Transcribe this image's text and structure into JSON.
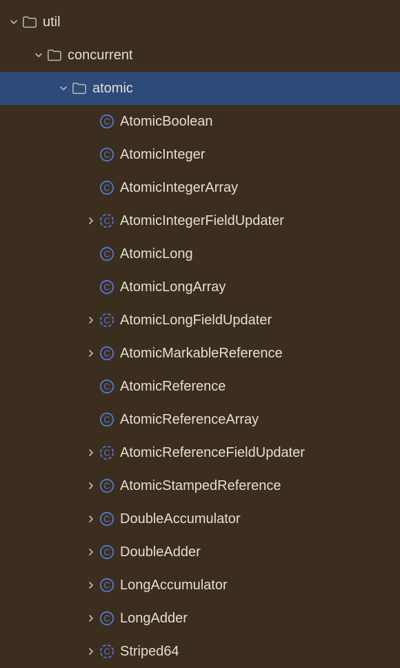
{
  "tree": {
    "util": {
      "label": "util",
      "expanded": true
    },
    "concurrent": {
      "label": "concurrent",
      "expanded": true
    },
    "atomic": {
      "label": "atomic",
      "expanded": true,
      "selected": true
    },
    "items": [
      {
        "label": "AtomicBoolean",
        "expandable": false,
        "abstract": false
      },
      {
        "label": "AtomicInteger",
        "expandable": false,
        "abstract": false
      },
      {
        "label": "AtomicIntegerArray",
        "expandable": false,
        "abstract": false
      },
      {
        "label": "AtomicIntegerFieldUpdater",
        "expandable": true,
        "abstract": true
      },
      {
        "label": "AtomicLong",
        "expandable": false,
        "abstract": false
      },
      {
        "label": "AtomicLongArray",
        "expandable": false,
        "abstract": false
      },
      {
        "label": "AtomicLongFieldUpdater",
        "expandable": true,
        "abstract": true
      },
      {
        "label": "AtomicMarkableReference",
        "expandable": true,
        "abstract": false
      },
      {
        "label": "AtomicReference",
        "expandable": false,
        "abstract": false
      },
      {
        "label": "AtomicReferenceArray",
        "expandable": false,
        "abstract": false
      },
      {
        "label": "AtomicReferenceFieldUpdater",
        "expandable": true,
        "abstract": true
      },
      {
        "label": "AtomicStampedReference",
        "expandable": true,
        "abstract": false
      },
      {
        "label": "DoubleAccumulator",
        "expandable": true,
        "abstract": false
      },
      {
        "label": "DoubleAdder",
        "expandable": true,
        "abstract": false
      },
      {
        "label": "LongAccumulator",
        "expandable": true,
        "abstract": false
      },
      {
        "label": "LongAdder",
        "expandable": true,
        "abstract": false
      },
      {
        "label": "Striped64",
        "expandable": true,
        "abstract": true
      }
    ]
  }
}
